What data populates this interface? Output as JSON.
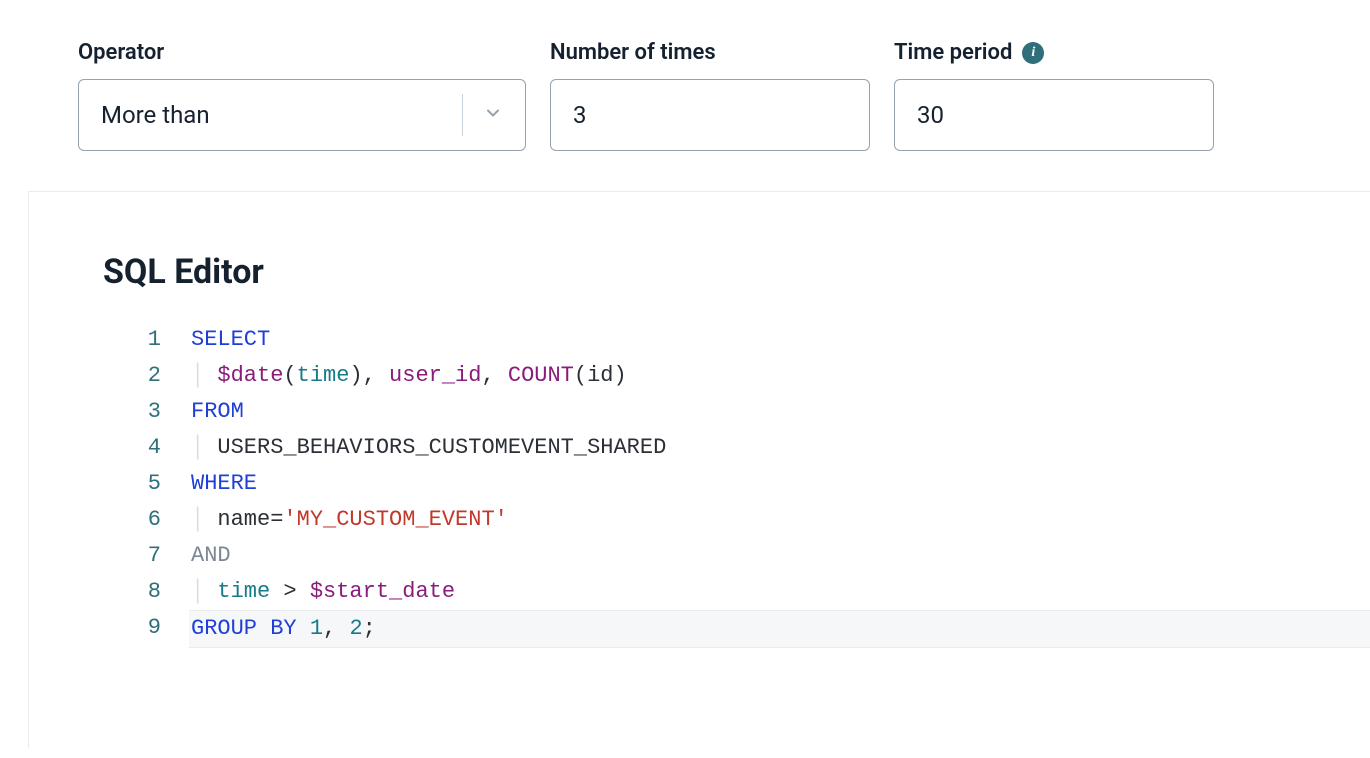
{
  "form": {
    "operator": {
      "label": "Operator",
      "value": "More than"
    },
    "times": {
      "label": "Number of times",
      "value": "3"
    },
    "period": {
      "label": "Time period",
      "value": "30",
      "info_glyph": "i"
    }
  },
  "editor": {
    "title": "SQL Editor",
    "active_line": 9,
    "lines": [
      {
        "n": 1,
        "indent": 0,
        "tokens": [
          [
            "keyword",
            "SELECT"
          ]
        ]
      },
      {
        "n": 2,
        "indent": 1,
        "tokens": [
          [
            "func",
            "$date"
          ],
          [
            "punc",
            "("
          ],
          [
            "ident",
            "time"
          ],
          [
            "punc",
            ")"
          ],
          [
            "punc",
            ", "
          ],
          [
            "col",
            "user_id"
          ],
          [
            "punc",
            ", "
          ],
          [
            "func",
            "COUNT"
          ],
          [
            "punc",
            "("
          ],
          [
            "plain",
            "id"
          ],
          [
            "punc",
            ")"
          ]
        ]
      },
      {
        "n": 3,
        "indent": 0,
        "tokens": [
          [
            "keyword",
            "FROM"
          ]
        ]
      },
      {
        "n": 4,
        "indent": 1,
        "tokens": [
          [
            "plain",
            "USERS_BEHAVIORS_CUSTOMEVENT_SHARED"
          ]
        ]
      },
      {
        "n": 5,
        "indent": 0,
        "tokens": [
          [
            "keyword",
            "WHERE"
          ]
        ]
      },
      {
        "n": 6,
        "indent": 1,
        "tokens": [
          [
            "plain",
            "name"
          ],
          [
            "op",
            "="
          ],
          [
            "string",
            "'MY_CUSTOM_EVENT'"
          ]
        ]
      },
      {
        "n": 7,
        "indent": 0,
        "tokens": [
          [
            "and",
            "AND"
          ]
        ]
      },
      {
        "n": 8,
        "indent": 1,
        "tokens": [
          [
            "ident",
            "time"
          ],
          [
            "plain",
            " "
          ],
          [
            "op",
            ">"
          ],
          [
            "plain",
            " "
          ],
          [
            "col",
            "$start_date"
          ]
        ]
      },
      {
        "n": 9,
        "indent": 0,
        "tokens": [
          [
            "keyword",
            "GROUP BY"
          ],
          [
            "plain",
            " "
          ],
          [
            "num",
            "1"
          ],
          [
            "punc",
            ", "
          ],
          [
            "num",
            "2"
          ],
          [
            "punc",
            ";"
          ]
        ]
      }
    ]
  }
}
